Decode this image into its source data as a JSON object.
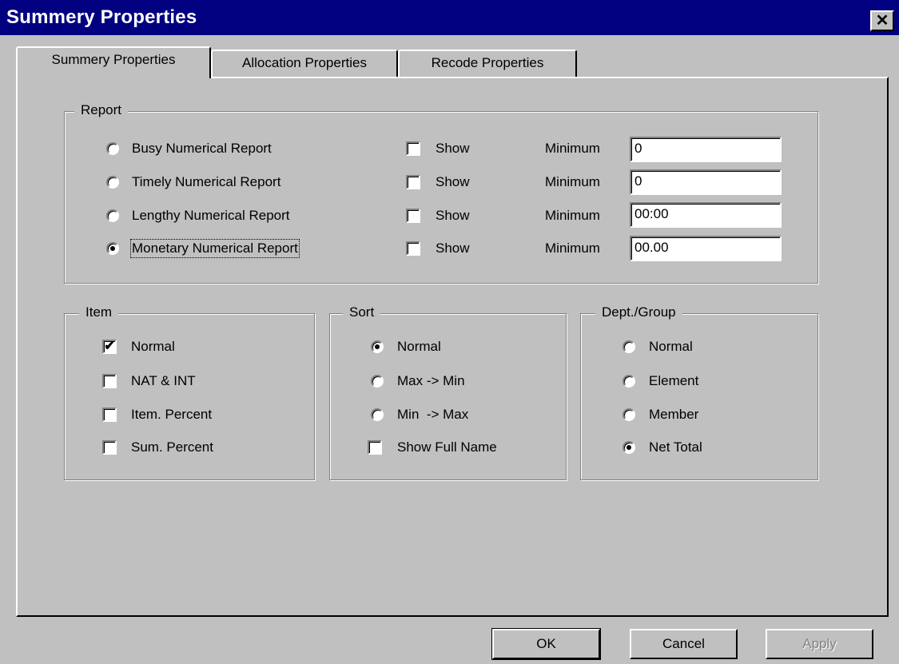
{
  "window": {
    "title": "Summery Properties",
    "close_glyph": "✕"
  },
  "tabs": [
    {
      "label": "Summery Properties",
      "active": true
    },
    {
      "label": "Allocation Properties",
      "active": false
    },
    {
      "label": "Recode Properties",
      "active": false
    }
  ],
  "report": {
    "legend": "Report",
    "rows": [
      {
        "label": "Busy Numerical Report",
        "selected": false,
        "show_label": "Show",
        "show_checked": false,
        "min_label": "Minimum",
        "min_value": "0"
      },
      {
        "label": "Timely Numerical Report",
        "selected": false,
        "show_label": "Show",
        "show_checked": false,
        "min_label": "Minimum",
        "min_value": "0"
      },
      {
        "label": "Lengthy Numerical Report",
        "selected": false,
        "show_label": "Show",
        "show_checked": false,
        "min_label": "Minimum",
        "min_value": "00:00"
      },
      {
        "label": "Monetary Numerical Report",
        "selected": true,
        "show_label": "Show",
        "show_checked": false,
        "min_label": "Minimum",
        "min_value": "00.00"
      }
    ]
  },
  "item": {
    "legend": "Item",
    "options": [
      {
        "label": "Normal",
        "checked": true
      },
      {
        "label": "NAT & INT",
        "checked": false
      },
      {
        "label": "Item. Percent",
        "checked": false
      },
      {
        "label": "Sum. Percent",
        "checked": false
      }
    ]
  },
  "sort": {
    "legend": "Sort",
    "options": [
      {
        "label": "Normal",
        "selected": true
      },
      {
        "label": "Max -> Min",
        "selected": false
      },
      {
        "label": "Min  -> Max",
        "selected": false
      }
    ],
    "show_full_name": {
      "label": "Show Full Name",
      "checked": false
    }
  },
  "dept_group": {
    "legend": "Dept./Group",
    "options": [
      {
        "label": "Normal",
        "selected": false
      },
      {
        "label": "Element",
        "selected": false
      },
      {
        "label": "Member",
        "selected": false
      },
      {
        "label": "Net Total",
        "selected": true
      }
    ]
  },
  "buttons": {
    "ok": "OK",
    "cancel": "Cancel",
    "apply": "Apply"
  },
  "colors": {
    "titlebar": "#000080",
    "face": "#c0c0c0"
  }
}
